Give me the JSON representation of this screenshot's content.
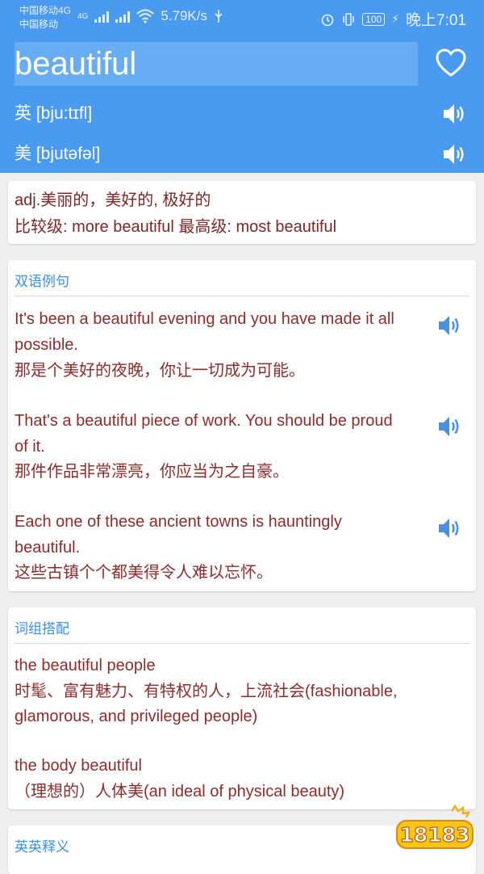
{
  "status": {
    "carrier1": "中国移动4G",
    "carrier2": "中国移动",
    "net_type": "4G",
    "speed": "5.79K/s",
    "battery": "100",
    "time": "晚上7:01"
  },
  "header": {
    "word": "beautiful",
    "uk_pron": "英 [bju:tɪfl]",
    "us_pron": "美 [bjutəfəl]"
  },
  "definition": {
    "line1": "adj.美丽的，美好的, 极好的",
    "line2": "比较级: more beautiful   最高级: most beautiful"
  },
  "examples": {
    "title": "双语例句",
    "items": [
      {
        "en1": "It's been a beautiful evening and you have made it all",
        "en2": "possible.",
        "zh": "那是个美好的夜晚，你让一切成为可能。"
      },
      {
        "en1": "That's a beautiful piece of work. You should be proud",
        "en2": "of it.",
        "zh": "那件作品非常漂亮，你应当为之自豪。"
      },
      {
        "en1": "Each one of these ancient towns is hauntingly",
        "en2": "beautiful.",
        "zh": "这些古镇个个都美得令人难以忘怀。"
      }
    ]
  },
  "phrases": {
    "title": "词组搭配",
    "items": [
      {
        "en": "the beautiful people",
        "zh1": "时髦、富有魅力、有特权的人，上流社会(fashionable,",
        "zh2": "glamorous, and privileged people)"
      },
      {
        "en": "the body beautiful",
        "zh1": "（理想的）人体美(an ideal of physical beauty)"
      }
    ]
  },
  "english_def": {
    "title": "英英释义"
  },
  "watermark": {
    "text": "18183"
  },
  "colors": {
    "header": "#4a9af0",
    "accent": "#3b8fe6",
    "text": "#8b2d2d"
  }
}
